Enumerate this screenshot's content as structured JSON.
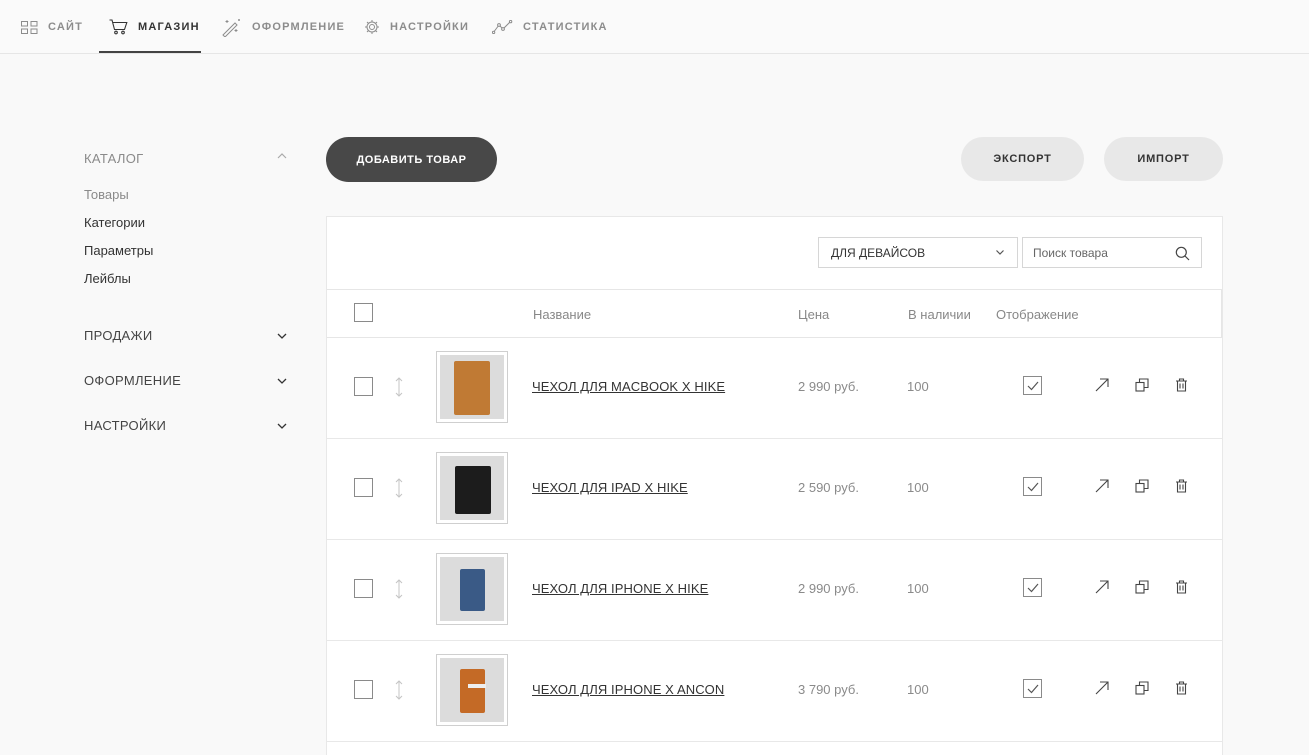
{
  "topnav": {
    "items": [
      {
        "label": "САЙТ"
      },
      {
        "label": "МАГАЗИН"
      },
      {
        "label": "ОФОРМЛЕНИЕ"
      },
      {
        "label": "НАСТРОЙКИ"
      },
      {
        "label": "СТАТИСТИКА"
      }
    ],
    "active": "МАГАЗИН"
  },
  "sidebar": {
    "catalog": {
      "title": "КАТАЛОГ",
      "items": [
        {
          "label": "Товары"
        },
        {
          "label": "Категории"
        },
        {
          "label": "Параметры"
        },
        {
          "label": "Лейблы"
        }
      ]
    },
    "sections": [
      {
        "label": "ПРОДАЖИ"
      },
      {
        "label": "ОФОРМЛЕНИЕ"
      },
      {
        "label": "НАСТРОЙКИ"
      }
    ]
  },
  "toolbar": {
    "add_label": "ДОБАВИТЬ ТОВАР",
    "export_label": "ЭКСПОРТ",
    "import_label": "ИМПОРТ"
  },
  "filter": {
    "category_selected": "ДЛЯ ДЕВАЙСОВ",
    "search_placeholder": "Поиск товара"
  },
  "table": {
    "headers": {
      "name": "Название",
      "price": "Цена",
      "stock": "В наличии",
      "visibility": "Отображение"
    },
    "rows": [
      {
        "name": "ЧЕХОЛ ДЛЯ MACBOOK X HIKE",
        "price": "2 990 руб.",
        "stock": "100",
        "visible": true,
        "product_color": "#c07a34"
      },
      {
        "name": "ЧЕХОЛ ДЛЯ IPAD X HIKE",
        "price": "2 590 руб.",
        "stock": "100",
        "visible": true,
        "product_color": "#1c1c1c"
      },
      {
        "name": "ЧЕХОЛ ДЛЯ IPHONE X HIKE",
        "price": "2 990 руб.",
        "stock": "100",
        "visible": true,
        "product_color": "#3a5a86"
      },
      {
        "name": "ЧЕХОЛ ДЛЯ IPHONE X ANCON",
        "price": "3 790 руб.",
        "stock": "100",
        "visible": true,
        "product_color": "#c46a26"
      }
    ]
  }
}
